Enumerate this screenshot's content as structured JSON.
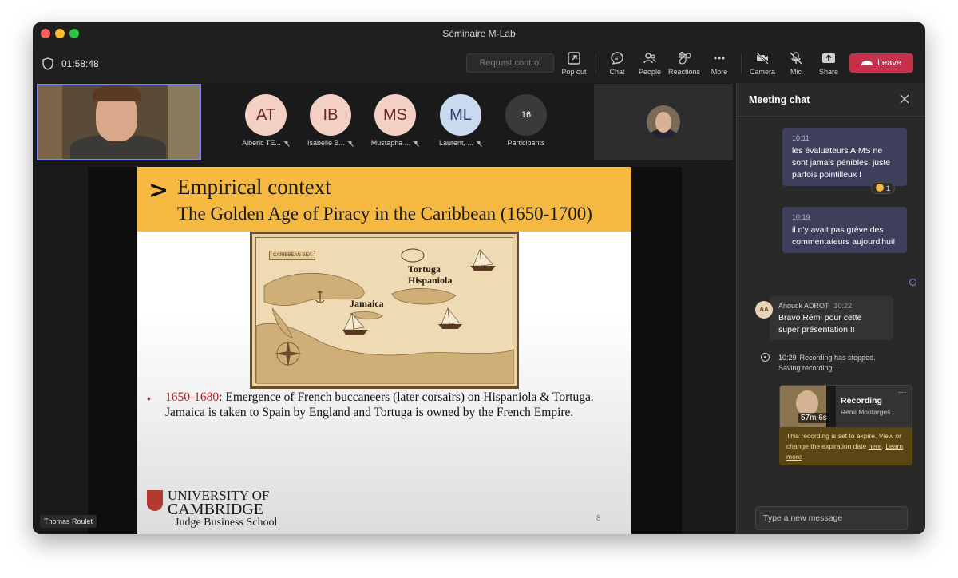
{
  "window": {
    "title": "Séminaire M-Lab"
  },
  "toolbar": {
    "timer": "01:58:48",
    "request_control": "Request control",
    "pop_out": "Pop out",
    "chat": "Chat",
    "people": "People",
    "reactions": "Reactions",
    "more": "More",
    "camera": "Camera",
    "mic": "Mic",
    "share": "Share",
    "leave": "Leave"
  },
  "participants_row": [
    {
      "initials": "AT",
      "name": "Alberic TE...",
      "color": "#f3d0c4",
      "text_color": "#6b2a1e"
    },
    {
      "initials": "IB",
      "name": "Isabelle B...",
      "color": "#f3d0c4",
      "text_color": "#6b2a1e"
    },
    {
      "initials": "MS",
      "name": "Mustapha ...",
      "color": "#f3d0c4",
      "text_color": "#6b2a1e"
    },
    {
      "initials": "ML",
      "name": "Laurent, ...",
      "color": "#c9d9f0",
      "text_color": "#24406b"
    }
  ],
  "participants_count": {
    "count": "16",
    "label": "Participants"
  },
  "slide": {
    "title": "Empirical context",
    "subtitle": "The Golden Age of Piracy in the Caribbean (1650-1700)",
    "map_labels": {
      "sea": "CARIBBEAN SEA",
      "tortuga": "Tortuga",
      "hispaniola": "Hispaniola",
      "jamaica": "Jamaica"
    },
    "bullet_date": "1650-1680",
    "bullet_text": ": Emergence of French buccaneers (later corsairs) on Hispaniola & Tortuga.",
    "bullet_text2": "Jamaica is taken to Spain by England and Tortuga is owned by the French Empire.",
    "logo_line1": "UNIVERSITY OF",
    "logo_line2": "CAMBRIDGE",
    "logo_line3": "Judge Business School",
    "page_number": "8"
  },
  "presenter_name": "Thomas Roulet",
  "chat": {
    "title": "Meeting chat",
    "messages": [
      {
        "time": "10:11",
        "text": "les évaluateurs AIMS ne sont jamais pénibles! juste parfois pointilleux !",
        "reaction_count": "1"
      },
      {
        "time": "10:19",
        "text": "il n'y avait pas grève des commentateurs aujourd'hui!"
      }
    ],
    "incoming": {
      "initials": "AA",
      "author": "Anouck ADROT",
      "time": "10:22",
      "text": "Bravo Rémi pour cette super présentation !!"
    },
    "recording_status": {
      "time": "10:29",
      "text": "Recording has stopped. Saving recording..."
    },
    "recording_card": {
      "duration": "57m 6s",
      "title": "Recording",
      "owner": "Remi Montarges",
      "more": "···",
      "warning_text": "This recording is set to expire. View or change the expiration date",
      "here": "here",
      "learn_more": "Learn more"
    },
    "compose_placeholder": "Type a new message"
  }
}
